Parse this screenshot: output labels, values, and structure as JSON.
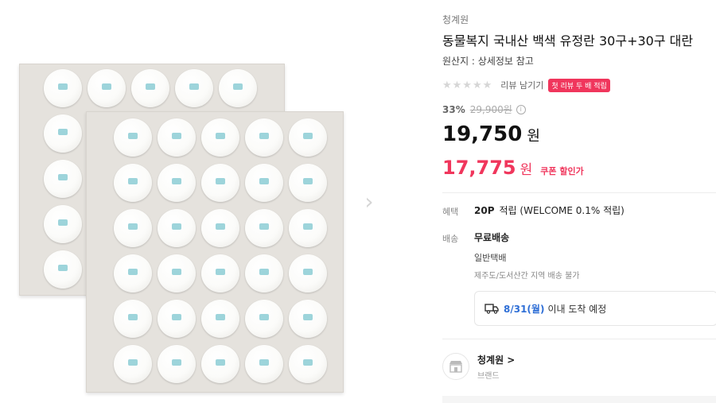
{
  "product": {
    "brand_top": "청계원",
    "title": "동물복지 국내산 백색 유정란 30구+30구 대란",
    "origin": "원산지 : 상세정보 참고",
    "rating_stars": "★★★★★",
    "review_link": "리뷰 남기기",
    "review_badge": "첫 리뷰 두 배 적립",
    "discount": "33%",
    "original_price": "29,900원",
    "info_icon": "i",
    "price": "19,750",
    "price_unit": "원",
    "coupon_price": "17,775",
    "coupon_unit": "원",
    "coupon_label": "쿠폰 할인가"
  },
  "benefit": {
    "label": "혜택",
    "points": "20P",
    "text": "적립 (WELCOME 0.1% 적립)"
  },
  "shipping": {
    "label": "배송",
    "main": "무료배송",
    "type": "일반택배",
    "note": "제주도/도서산간 지역 배송 불가",
    "delivery_date": "8/31(월)",
    "delivery_text": "이내 도착 예정"
  },
  "store": {
    "name": "청계원 >",
    "sub": "브랜드"
  },
  "gallery": {
    "next_arrow": "›"
  },
  "colors": {
    "accent_pink": "#f0365c",
    "delivery_blue": "#2f6fd6"
  }
}
